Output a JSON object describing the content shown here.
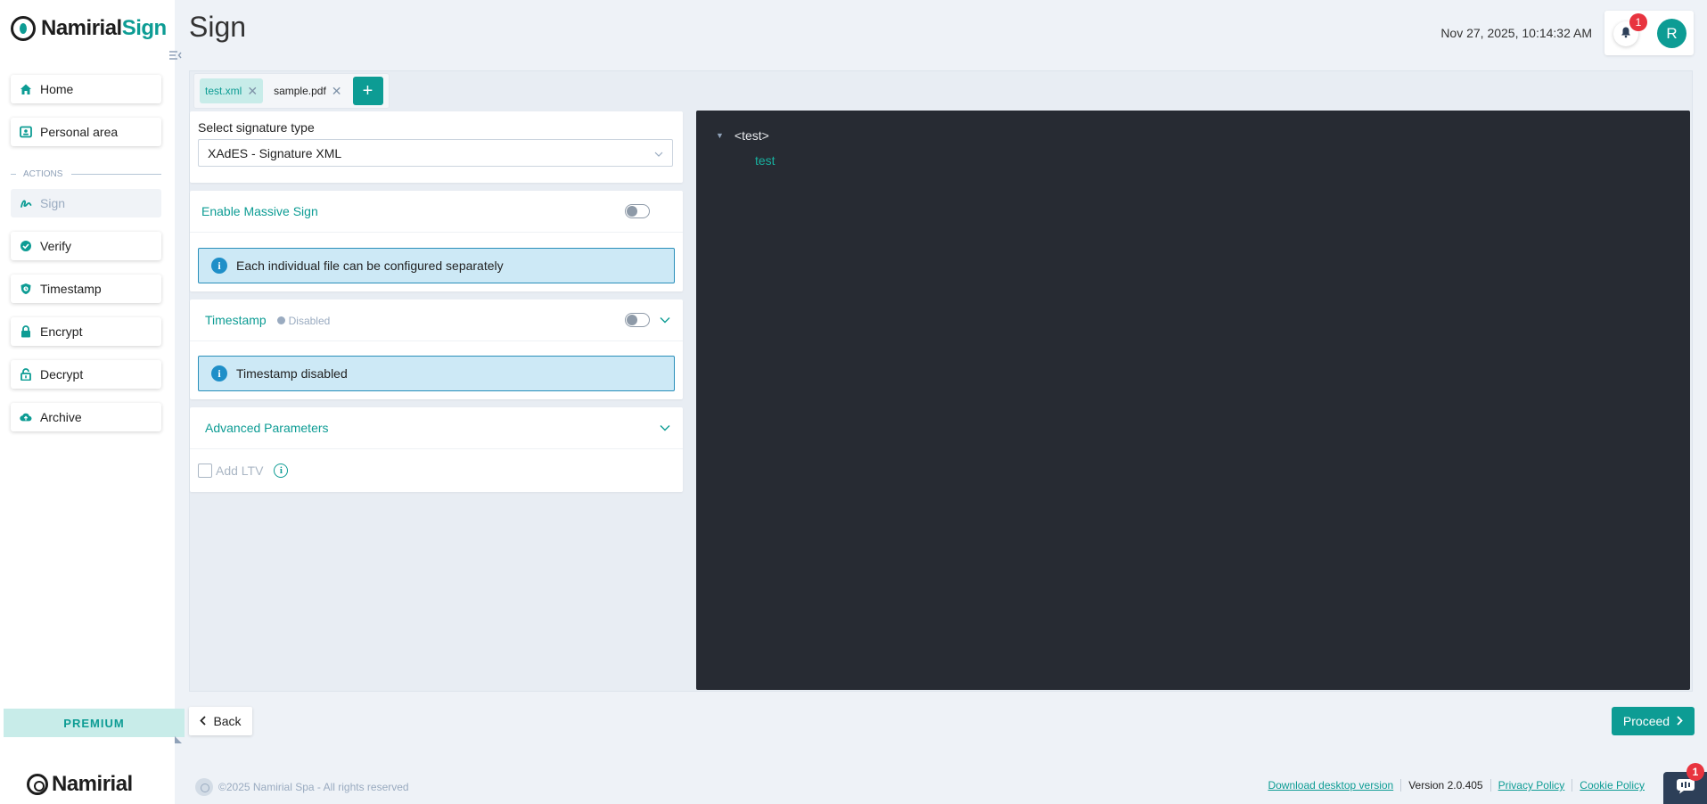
{
  "app": {
    "logo_part1": "Namirial",
    "logo_part2": "Sign",
    "footer_brand": "Namirial"
  },
  "sidebar": {
    "items": [
      {
        "label": "Home",
        "icon": "home-icon"
      },
      {
        "label": "Personal area",
        "icon": "id-card-icon"
      }
    ],
    "section_label": "ACTIONS",
    "actions": [
      {
        "label": "Sign",
        "icon": "signature-icon",
        "active": true
      },
      {
        "label": "Verify",
        "icon": "verified-badge-icon"
      },
      {
        "label": "Timestamp",
        "icon": "shield-clock-icon"
      },
      {
        "label": "Encrypt",
        "icon": "lock-icon"
      },
      {
        "label": "Decrypt",
        "icon": "unlock-icon"
      },
      {
        "label": "Archive",
        "icon": "cloud-upload-icon"
      }
    ],
    "premium_label": "PREMIUM"
  },
  "header": {
    "title": "Sign",
    "datetime": "Nov 27, 2025, 10:14:32 AM",
    "notifications_count": "1",
    "avatar_initial": "R"
  },
  "tabs": [
    {
      "label": "test.xml",
      "active": true
    },
    {
      "label": "sample.pdf",
      "active": false
    }
  ],
  "add_tab_label": "+",
  "signature": {
    "label": "Select signature type",
    "selected": "XAdES - Signature XML"
  },
  "massive": {
    "title": "Enable Massive Sign",
    "info": "Each individual file can be configured separately"
  },
  "timestamp": {
    "title": "Timestamp",
    "status": "Disabled",
    "info": "Timestamp disabled"
  },
  "advanced": {
    "title": "Advanced Parameters",
    "add_ltv_label": "Add LTV"
  },
  "xml": {
    "tag": "<test>",
    "text": "test"
  },
  "buttons": {
    "back": "Back",
    "proceed": "Proceed"
  },
  "footer": {
    "copyright": "©2025 Namirial Spa - All rights reserved",
    "download": "Download desktop version",
    "version": "Version 2.0.405",
    "privacy": "Privacy Policy",
    "cookie": "Cookie Policy",
    "chat_badge": "1"
  },
  "colors": {
    "accent": "#0d9c94",
    "info_bg": "#cde9f6",
    "viewer_bg": "#272b33",
    "badge": "#e8343f"
  }
}
